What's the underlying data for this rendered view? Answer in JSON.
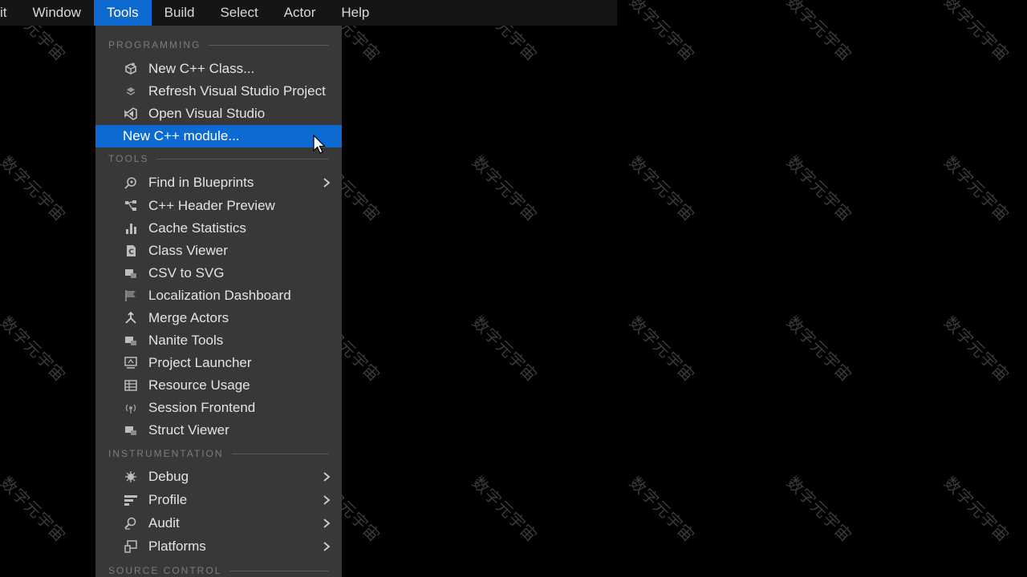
{
  "menubar": {
    "items": [
      {
        "label": "it"
      },
      {
        "label": "Window"
      },
      {
        "label": "Tools"
      },
      {
        "label": "Build"
      },
      {
        "label": "Select"
      },
      {
        "label": "Actor"
      },
      {
        "label": "Help"
      }
    ],
    "active": "Tools"
  },
  "dropdown": {
    "sections": [
      {
        "label": "PROGRAMMING"
      },
      {
        "label": "TOOLS"
      },
      {
        "label": "INSTRUMENTATION"
      },
      {
        "label": "SOURCE CONTROL"
      }
    ],
    "programming_items": [
      {
        "label": "New C++ Class...",
        "icon": "cube-add-icon"
      },
      {
        "label": "Refresh Visual Studio Project",
        "icon": "refresh-icon"
      },
      {
        "label": "Open Visual Studio",
        "icon": "visual-studio-icon"
      },
      {
        "label": "New C++ module...",
        "icon": "",
        "highlighted": true
      }
    ],
    "tools_items": [
      {
        "label": "Find in Blueprints",
        "icon": "search-icon",
        "submenu": true
      },
      {
        "label": "C++ Header Preview",
        "icon": "header-preview-icon"
      },
      {
        "label": "Cache Statistics",
        "icon": "bar-chart-icon"
      },
      {
        "label": "Class Viewer",
        "icon": "class-icon"
      },
      {
        "label": "CSV to SVG",
        "icon": "document-icon"
      },
      {
        "label": "Localization Dashboard",
        "icon": "flag-icon"
      },
      {
        "label": "Merge Actors",
        "icon": "merge-icon"
      },
      {
        "label": "Nanite Tools",
        "icon": "nanite-icon"
      },
      {
        "label": "Project Launcher",
        "icon": "launcher-icon"
      },
      {
        "label": "Resource Usage",
        "icon": "table-icon"
      },
      {
        "label": "Session Frontend",
        "icon": "session-icon"
      },
      {
        "label": "Struct Viewer",
        "icon": "struct-icon"
      }
    ],
    "instrumentation_items": [
      {
        "label": "Debug",
        "icon": "bug-icon",
        "submenu": true
      },
      {
        "label": "Profile",
        "icon": "profile-icon",
        "submenu": true
      },
      {
        "label": "Audit",
        "icon": "audit-icon",
        "submenu": true
      },
      {
        "label": "Platforms",
        "icon": "platforms-icon",
        "submenu": true
      }
    ]
  },
  "watermark": {
    "text": "数字元宇宙"
  },
  "colors": {
    "accent": "#0d6ad0",
    "menu_bg": "#383838",
    "menubar_bg": "#151515",
    "background": "#000000"
  }
}
